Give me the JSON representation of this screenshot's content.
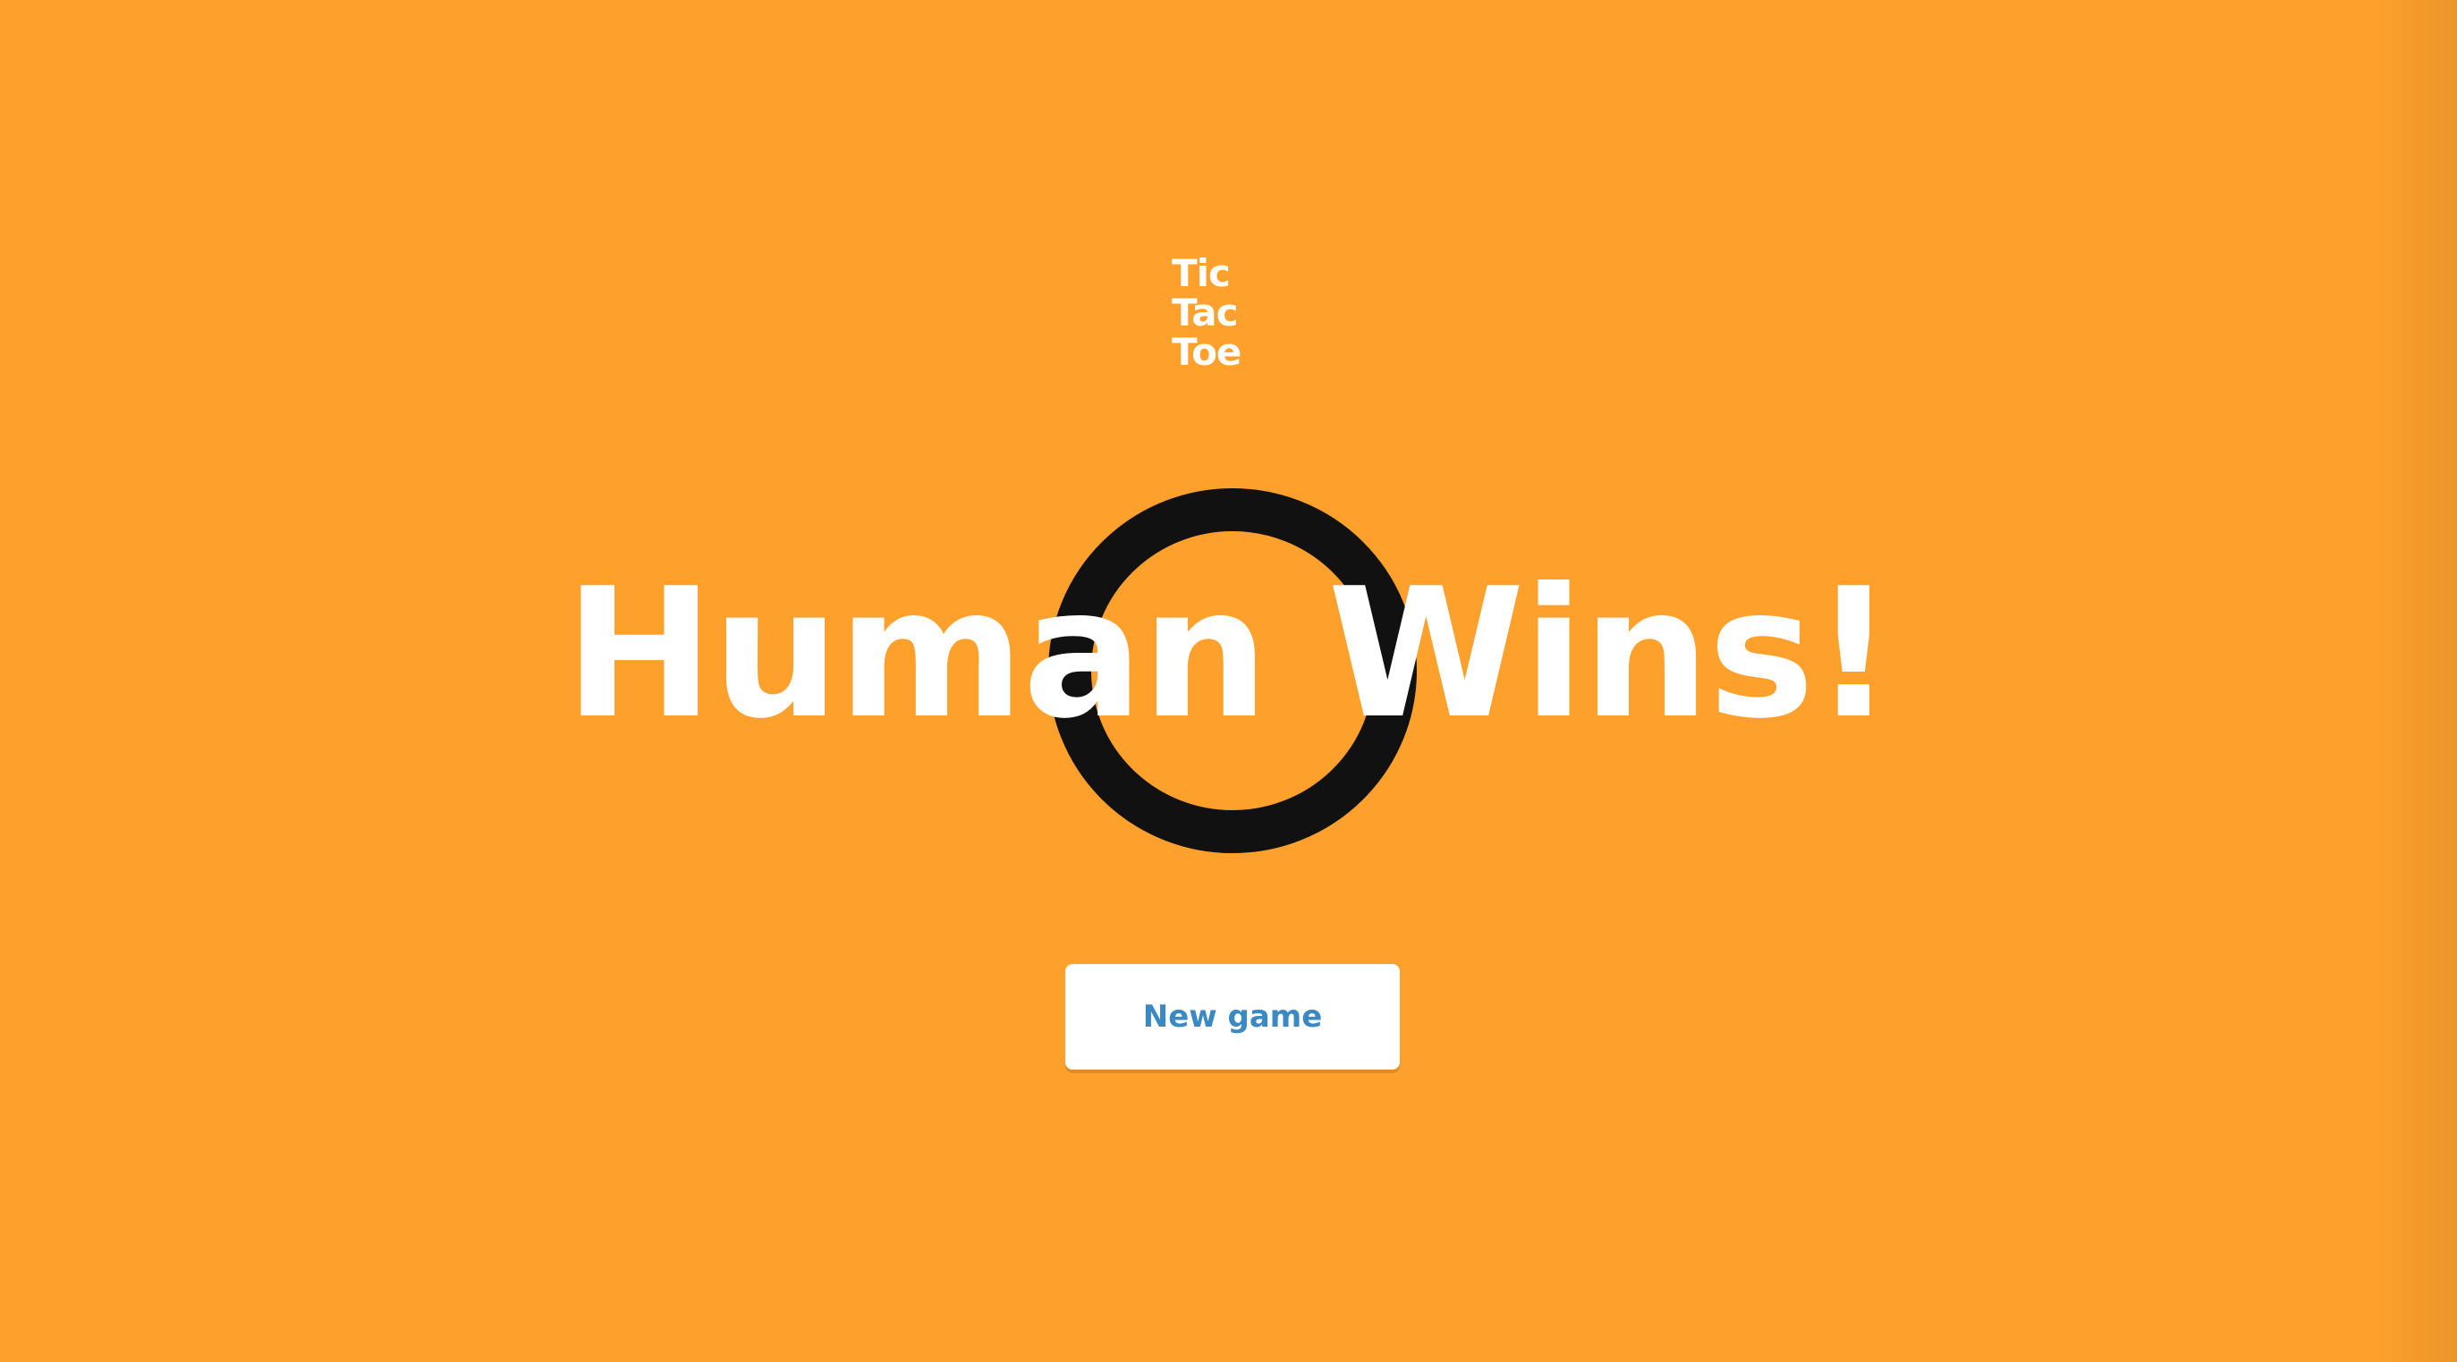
{
  "logo": {
    "line1": "Tic",
    "line2": "Tac",
    "line3": "Toe"
  },
  "winner_mark": {
    "icon": "o-mark-icon",
    "color": "#111111"
  },
  "result": {
    "headline": "Human Wins!"
  },
  "actions": {
    "new_game_label": "New game"
  },
  "colors": {
    "background": "#fda02c",
    "text": "#ffffff",
    "button_text": "#3a89c4"
  }
}
